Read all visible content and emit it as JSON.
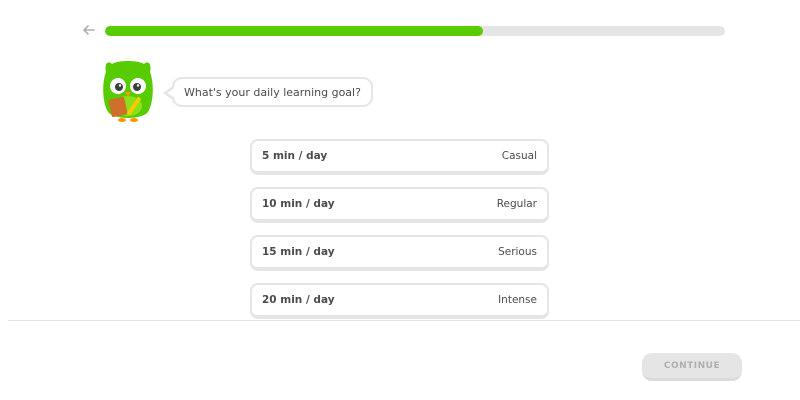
{
  "header": {
    "back_icon": "arrow-left-icon",
    "progress_fraction": 0.61,
    "progress_color": "#58cc02",
    "track_color": "#e5e5e5"
  },
  "prompt": {
    "mascot_icon": "green-owl-mascot-icon",
    "question": "What's your daily learning goal?"
  },
  "options": [
    {
      "time": "5 min / day",
      "level": "Casual"
    },
    {
      "time": "10 min / day",
      "level": "Regular"
    },
    {
      "time": "15 min / day",
      "level": "Serious"
    },
    {
      "time": "20 min / day",
      "level": "Intense"
    }
  ],
  "footer": {
    "continue_label": "CONTINUE",
    "continue_enabled": false
  }
}
